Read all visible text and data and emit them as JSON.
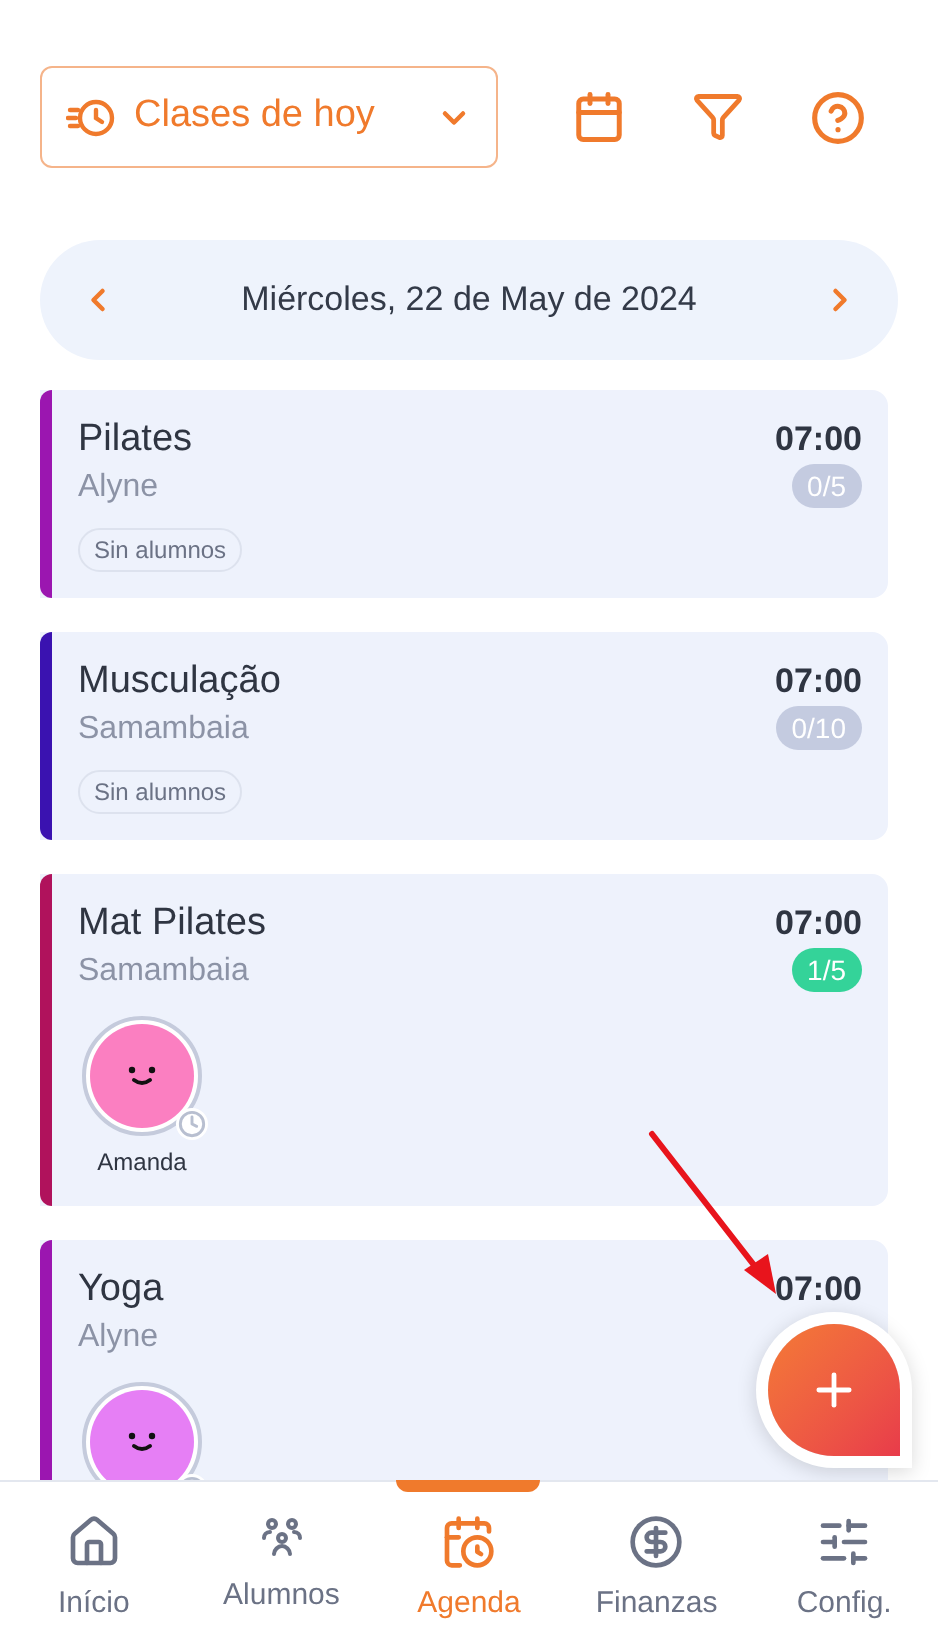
{
  "toolbar": {
    "view_button": {
      "label": "Clases de hoy"
    }
  },
  "date_bar": {
    "label": "Miércoles, 22 de May de 2024"
  },
  "classes": [
    {
      "name": "Pilates",
      "location": "Alyne",
      "time": "07:00",
      "count": "0/5",
      "has_students": false,
      "color": "#9b16b0",
      "kind": "empty",
      "empty_label": "Sin alumnos"
    },
    {
      "name": "Musculação",
      "location": "Samambaia",
      "time": "07:00",
      "count": "0/10",
      "has_students": false,
      "color": "#3a12b0",
      "kind": "empty",
      "empty_label": "Sin alumnos"
    },
    {
      "name": "Mat Pilates",
      "location": "Samambaia",
      "time": "07:00",
      "count": "1/5",
      "has_students": true,
      "color": "#b0125c",
      "kind": "students",
      "students": [
        {
          "name": "Amanda",
          "color": "#fb7fc1"
        }
      ]
    },
    {
      "name": "Yoga",
      "location": "Alyne",
      "time": "07:00",
      "color": "#9b16b0",
      "kind": "students",
      "students": [
        {
          "color": "#e67ff5"
        }
      ]
    }
  ],
  "bottom_nav": [
    {
      "label": "Início",
      "selected": false
    },
    {
      "label": "Alumnos",
      "selected": false
    },
    {
      "label": "Agenda",
      "selected": true
    },
    {
      "label": "Finanzas",
      "selected": false
    },
    {
      "label": "Config.",
      "selected": false
    }
  ]
}
